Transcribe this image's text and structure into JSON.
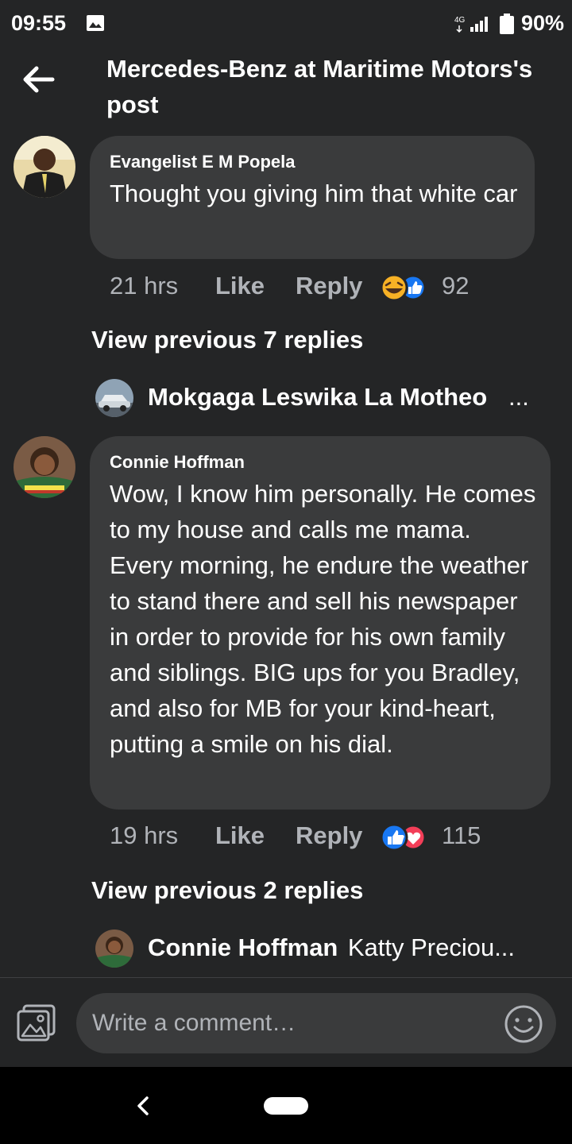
{
  "status_bar": {
    "time": "09:55",
    "network": "4G",
    "battery": "90%"
  },
  "header": {
    "title": "Mercedes-Benz at Maritime Motors's post"
  },
  "comments": [
    {
      "author": "Evangelist E M Popela",
      "text": "Thought you giving him that white car",
      "time": "21 hrs",
      "like_label": "Like",
      "reply_label": "Reply",
      "reaction_count": "92",
      "reactions": [
        "haha",
        "like"
      ],
      "view_previous": "View previous 7 replies",
      "latest_reply": {
        "name": "Mokgaga Leswika La Motheo",
        "snippet": "...",
        "avatar_icon": "car-photo-avatar"
      }
    },
    {
      "author": "Connie Hoffman",
      "text": "Wow, I know him personally. He comes to my house and calls me mama. Every morning, he endure the weather to stand there and sell his newspaper in order to provide for his own family and siblings. BIG ups for you Bradley, and also for MB for your kind-heart, putting a smile on his dial.",
      "time": "19 hrs",
      "like_label": "Like",
      "reply_label": "Reply",
      "reaction_count": "115",
      "reactions": [
        "like",
        "love"
      ],
      "view_previous": "View previous 2 replies",
      "latest_reply": {
        "name": "Connie Hoffman",
        "snippet": "Katty Preciou...",
        "avatar_icon": "profile-photo-avatar"
      }
    }
  ],
  "composer": {
    "placeholder": "Write a comment…"
  },
  "colors": {
    "background": "#242526",
    "bubble": "#3a3b3c",
    "secondary_text": "#b0b3b8",
    "like_blue": "#1877f2",
    "love_red": "#f33e58",
    "haha_yellow": "#f7b125"
  }
}
